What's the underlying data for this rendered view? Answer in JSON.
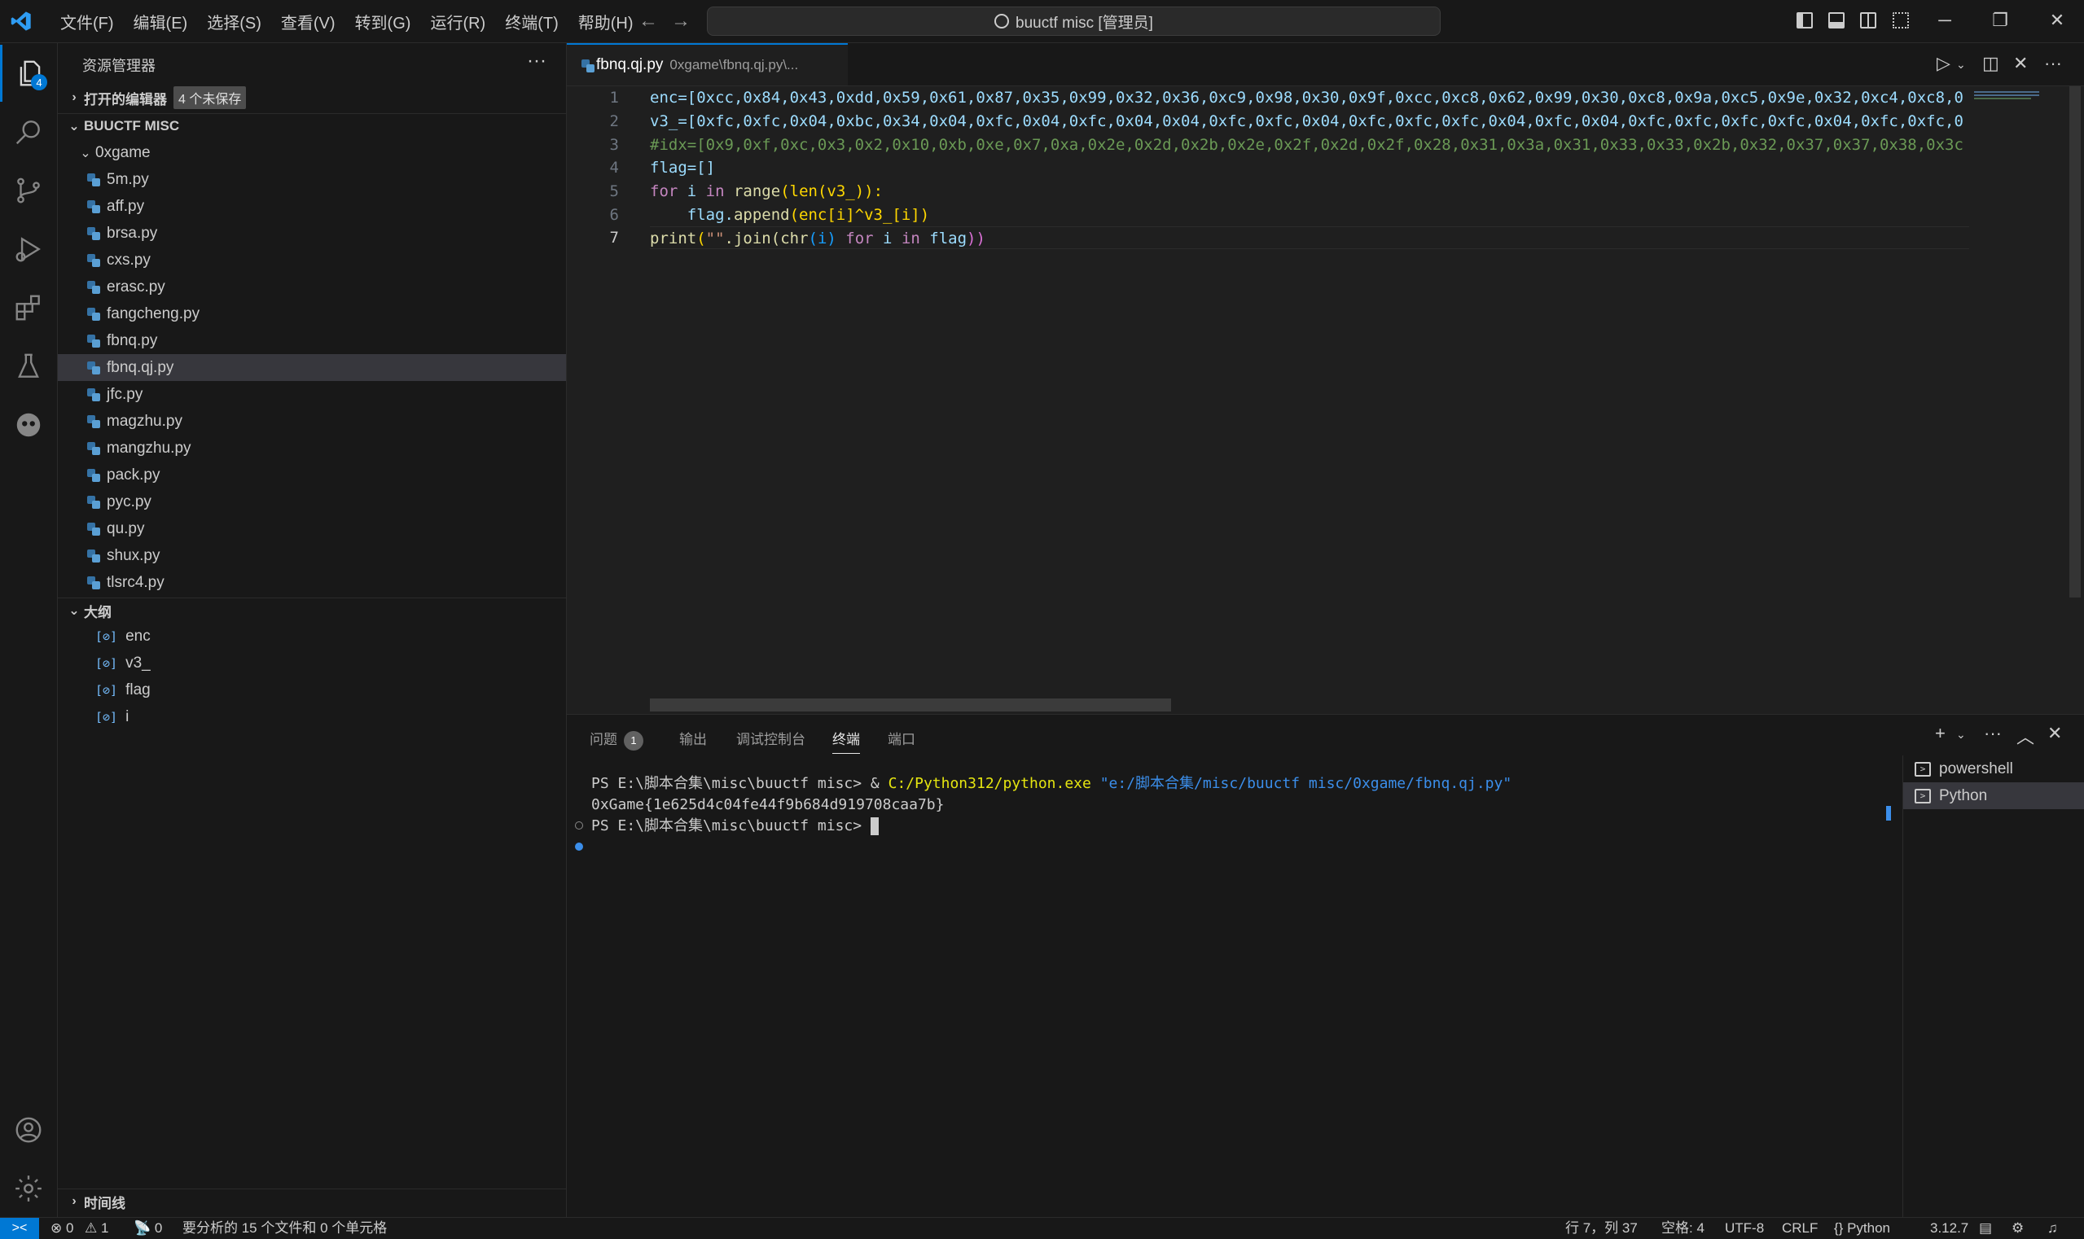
{
  "titlebar": {
    "menu": [
      "文件(F)",
      "编辑(E)",
      "选择(S)",
      "查看(V)",
      "转到(G)",
      "运行(R)",
      "终端(T)",
      "帮助(H)"
    ],
    "command_center": "buuctf misc [管理员]",
    "back_arrow": "←",
    "forward_arrow": "→",
    "minimize": "─",
    "restore": "❐",
    "close": "✕"
  },
  "activitybar": {
    "explorer_badge": "4",
    "icons": [
      "files-icon",
      "search-icon",
      "source-control-icon",
      "run-debug-icon",
      "extensions-icon",
      "testing-icon",
      "copilot-icon",
      "account-icon",
      "gear-icon"
    ]
  },
  "sidebar": {
    "title": "资源管理器",
    "more": "···",
    "open_editors": {
      "label": "打开的编辑器",
      "badge": "4 个未保存"
    },
    "workspace": "BUUCTF MISC",
    "folder": "0xgame",
    "files": [
      "5m.py",
      "aff.py",
      "brsa.py",
      "cxs.py",
      "erasc.py",
      "fangcheng.py",
      "fbnq.py",
      "fbnq.qj.py",
      "jfc.py",
      "magzhu.py",
      "mangzhu.py",
      "pack.py",
      "pyc.py",
      "qu.py",
      "shux.py",
      "tlsrc4.py"
    ],
    "selected_file": "fbnq.qj.py",
    "outline": {
      "label": "大纲",
      "items": [
        "enc",
        "v3_",
        "flag",
        "i"
      ]
    },
    "timeline": "时间线"
  },
  "editor": {
    "tab": {
      "name": "fbnq.qj.py",
      "path": "0xgame\\fbnq.qj.py\\..."
    },
    "line_numbers": [
      "1",
      "2",
      "3",
      "4",
      "5",
      "6",
      "7"
    ],
    "lines": {
      "l1": "enc=[0xcc,0x84,0x43,0xdd,0x59,0x61,0x87,0x35,0x99,0x32,0x36,0xc9,0x98,0x30,0x9f,0xcc,0xc8,0x62,0x99,0x30,0xc8,0x9a,0xc5,0x9e,0x32,0xc4,0xc8,0",
      "l2": "v3_=[0xfc,0xfc,0x04,0xbc,0x34,0x04,0xfc,0x04,0xfc,0x04,0x04,0xfc,0xfc,0x04,0xfc,0xfc,0xfc,0x04,0xfc,0x04,0xfc,0xfc,0xfc,0xfc,0x04,0xfc,0xfc,0",
      "l3": "#idx=[0x9,0xf,0xc,0x3,0x2,0x10,0xb,0xe,0x7,0xa,0x2e,0x2d,0x2b,0x2e,0x2f,0x2d,0x2f,0x28,0x31,0x3a,0x31,0x33,0x33,0x2b,0x32,0x37,0x37,0x38,0x3c",
      "l4": "flag=[]",
      "l5_kw1": "for",
      "l5_var": " i ",
      "l5_kw2": "in",
      "l5_fn": " range",
      "l5_rest": "(len(v3_)):",
      "l6_indent": "    flag.",
      "l6_fn": "append",
      "l6_rest": "(enc[i]^v3_[i])",
      "l7_fn": "print",
      "l7_open": "(",
      "l7_str": "\"\"",
      "l7_join": ".join(",
      "l7_chr": "chr",
      "l7_arg": "(i) ",
      "l7_for": "for",
      "l7_i": " i ",
      "l7_in": "in",
      "l7_flag": " flag",
      "l7_close": "))"
    }
  },
  "panel": {
    "tabs": [
      "问题",
      "输出",
      "调试控制台",
      "终端",
      "端口"
    ],
    "problems_count": "1",
    "active_tab": "终端",
    "terminal": {
      "line1_prompt": "PS E:\\脚本合集\\misc\\buuctf misc> & ",
      "line1_exe": "C:/Python312/python.exe",
      "line1_arg": " \"e:/脚本合集/misc/buuctf misc/0xgame/fbnq.qj.py\"",
      "line2": "0xGame{1e625d4c04fe44f9b684d919708caa7b}",
      "line3": "PS E:\\脚本合集\\misc\\buuctf misc> "
    },
    "terminals": [
      "powershell",
      "Python"
    ],
    "selected_terminal": "Python"
  },
  "statusbar": {
    "remote": "><",
    "errors": "⊗ 0",
    "warnings": "⚠ 1",
    "ports": "📡 0",
    "analysis": "要分析的 15 个文件和 0 个单元格",
    "position": "行 7，列 37",
    "spaces": "空格: 4",
    "encoding": "UTF-8",
    "eol": "CRLF",
    "language": "{} Python",
    "version": "3.12.7"
  }
}
